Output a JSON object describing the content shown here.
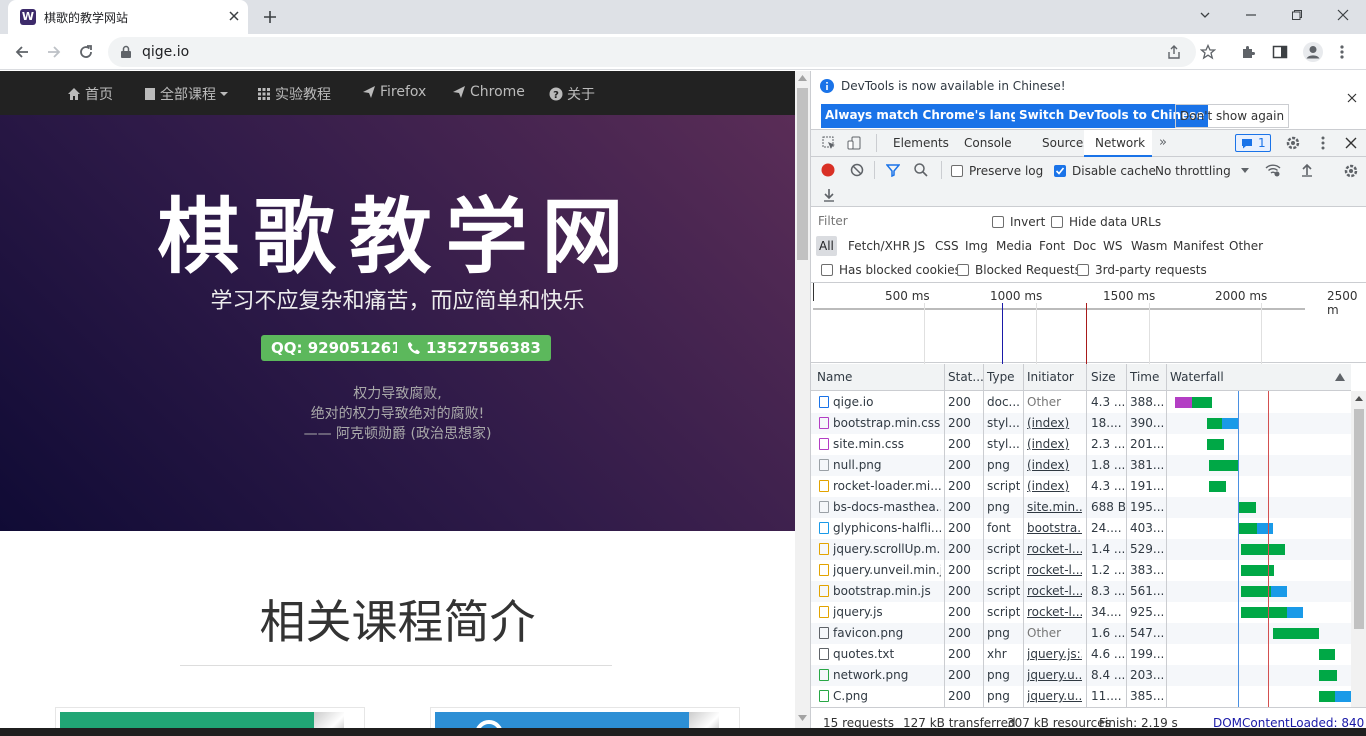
{
  "browser": {
    "tab_title": "棋歌的教学网站",
    "tab_favicon_letter": "W",
    "url": "qige.io"
  },
  "site": {
    "nav": [
      "首页",
      "全部课程",
      "实验教程",
      "Firefox",
      "Chrome",
      "关于"
    ],
    "hero_title": "棋歌教学网",
    "hero_subtitle": "学习不应复杂和痛苦，而应简单和快乐",
    "qq": "QQ: 929051261",
    "phone": "13527556383",
    "quote_line1": "权力导致腐败,",
    "quote_line2": "绝对的权力导致绝对的腐败!",
    "quote_line3": "—— 阿克顿勋爵 (政治思想家)",
    "section_title": "相关课程简介"
  },
  "devtools": {
    "info_text": "DevTools is now available in Chinese!",
    "btn_match": "Always match Chrome's language",
    "btn_switch": "Switch DevTools to Chinese",
    "btn_dont": "Don't show again",
    "tabs": [
      "Elements",
      "Console",
      "Sources",
      "Network"
    ],
    "issues_count": "1",
    "preserve_log": "Preserve log",
    "disable_cache": "Disable cache",
    "throttling": "No throttling",
    "filter_placeholder": "Filter",
    "invert": "Invert",
    "hide_data_urls": "Hide data URLs",
    "types": [
      "All",
      "Fetch/XHR",
      "JS",
      "CSS",
      "Img",
      "Media",
      "Font",
      "Doc",
      "WS",
      "Wasm",
      "Manifest",
      "Other"
    ],
    "blocked_cookies": "Has blocked cookies",
    "blocked_requests": "Blocked Requests",
    "third_party": "3rd-party requests",
    "timeline_ticks": [
      "500 ms",
      "1000 ms",
      "1500 ms",
      "2000 ms",
      "2500 m"
    ],
    "columns": [
      "Name",
      "Stat...",
      "Type",
      "Initiator",
      "Size",
      "Time",
      "Waterfall"
    ],
    "rows": [
      {
        "name": "qige.io",
        "status": "200",
        "type": "doc...",
        "initiator": "Other",
        "size": "4.3 ...",
        "time": "388...",
        "icon": "doc"
      },
      {
        "name": "bootstrap.min.css",
        "status": "200",
        "type": "styl...",
        "initiator": "(index)",
        "size": "18....",
        "time": "390...",
        "icon": "css"
      },
      {
        "name": "site.min.css",
        "status": "200",
        "type": "styl...",
        "initiator": "(index)",
        "size": "2.3 ...",
        "time": "201...",
        "icon": "css"
      },
      {
        "name": "null.png",
        "status": "200",
        "type": "png",
        "initiator": "(index)",
        "size": "1.8 ...",
        "time": "381...",
        "icon": "img"
      },
      {
        "name": "rocket-loader.mi...",
        "status": "200",
        "type": "script",
        "initiator": "(index)",
        "size": "4.3 ...",
        "time": "191...",
        "icon": "js"
      },
      {
        "name": "bs-docs-masthea...",
        "status": "200",
        "type": "png",
        "initiator": "site.min....",
        "size": "688 B",
        "time": "195...",
        "icon": "img"
      },
      {
        "name": "glyphicons-halfli...",
        "status": "200",
        "type": "font",
        "initiator": "bootstra...",
        "size": "24....",
        "time": "403...",
        "icon": "font"
      },
      {
        "name": "jquery.scrollUp.m...",
        "status": "200",
        "type": "script",
        "initiator": "rocket-l...",
        "size": "1.4 ...",
        "time": "529...",
        "icon": "js"
      },
      {
        "name": "jquery.unveil.min.js",
        "status": "200",
        "type": "script",
        "initiator": "rocket-l...",
        "size": "1.2 ...",
        "time": "383...",
        "icon": "js"
      },
      {
        "name": "bootstrap.min.js",
        "status": "200",
        "type": "script",
        "initiator": "rocket-l...",
        "size": "8.3 ...",
        "time": "561...",
        "icon": "js"
      },
      {
        "name": "jquery.js",
        "status": "200",
        "type": "script",
        "initiator": "rocket-l...",
        "size": "34....",
        "time": "925...",
        "icon": "js"
      },
      {
        "name": "favicon.png",
        "status": "200",
        "type": "png",
        "initiator": "Other",
        "size": "1.6 ...",
        "time": "547...",
        "icon": "other"
      },
      {
        "name": "quotes.txt",
        "status": "200",
        "type": "xhr",
        "initiator": "jquery.js:3",
        "size": "4.6 ...",
        "time": "199...",
        "icon": "other"
      },
      {
        "name": "network.png",
        "status": "200",
        "type": "png",
        "initiator": "jquery.u...",
        "size": "8.4 ...",
        "time": "203...",
        "icon": "img2"
      },
      {
        "name": "C.png",
        "status": "200",
        "type": "png",
        "initiator": "jquery.u...",
        "size": "11....",
        "time": "385...",
        "icon": "img2"
      }
    ],
    "footer": {
      "requests": "15 requests",
      "transferred": "127 kB transferred",
      "resources": "307 kB resources",
      "finish": "Finish: 2.19 s",
      "domcontent": "DOMContentLoaded: 840 ms"
    },
    "colors": {
      "accent": "#1a73e8",
      "waiting": "#00a846",
      "download": "#1a9ae8"
    }
  }
}
